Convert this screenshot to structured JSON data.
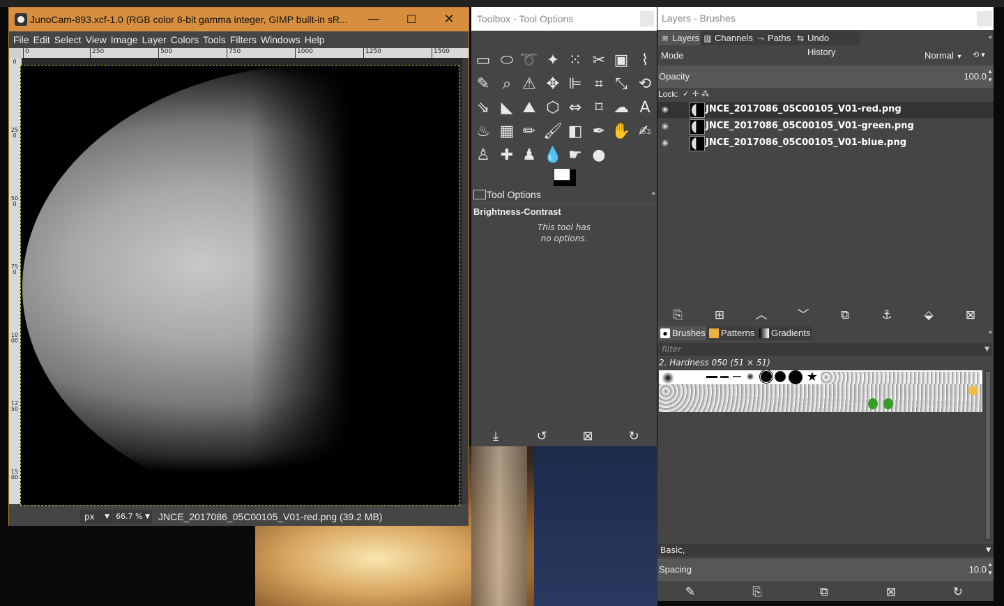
{
  "image_window": {
    "title": "JunoCam-893.xcf-1.0 (RGB color 8-bit gamma integer, GIMP built-in sR...",
    "menu": [
      "File",
      "Edit",
      "Select",
      "View",
      "Image",
      "Layer",
      "Colors",
      "Tools",
      "Filters",
      "Windows",
      "Help"
    ],
    "ruler_h_ticks": [
      "0",
      "250",
      "500",
      "750",
      "1000",
      "1250",
      "1500"
    ],
    "ruler_v_ticks": [
      "0",
      "250",
      "500",
      "750",
      "1000",
      "1250",
      "1500"
    ],
    "status": {
      "unit": "px",
      "zoom": "66.7 %",
      "file_info": "JNCE_2017086_05C00105_V01-red.png (39.2 MB)"
    },
    "buttons": {
      "minimize": "—",
      "maximize": "☐",
      "close": "✕"
    }
  },
  "toolbox": {
    "title": "Toolbox - Tool Options",
    "tool_options_tab": "Tool Options",
    "active_tool": "Brightness-Contrast",
    "message_line1": "This tool has",
    "message_line2": "no options."
  },
  "layers_panel": {
    "title": "Layers - Brushes",
    "tabs": [
      "Layers",
      "Channels",
      "Paths",
      "Undo History"
    ],
    "mode_label": "Mode",
    "mode_value": "Normal",
    "opacity_label": "Opacity",
    "opacity_value": "100.0",
    "lock_label": "Lock:",
    "layers": [
      {
        "name": "JNCE_2017086_05C00105_V01-red.png"
      },
      {
        "name": "JNCE_2017086_05C00105_V01-green.png"
      },
      {
        "name": "JNCE_2017086_05C00105_V01-blue.png"
      }
    ]
  },
  "brushes_panel": {
    "tabs": [
      "Brushes",
      "Patterns",
      "Gradients"
    ],
    "filter_placeholder": "filter",
    "brush_name": "2. Hardness 050 (51 × 51)",
    "basic": "Basic,",
    "spacing_label": "Spacing",
    "spacing_value": "10.0"
  }
}
